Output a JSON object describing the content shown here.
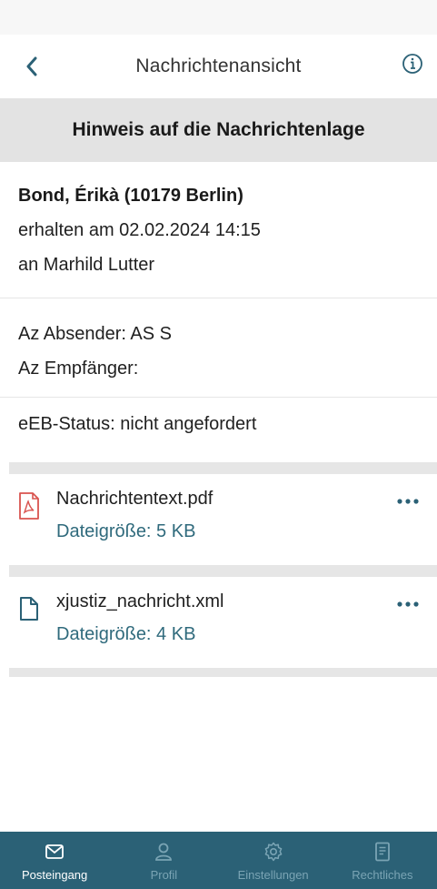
{
  "header": {
    "title": "Nachrichtenansicht",
    "back_icon": "chevron-left-icon",
    "info_icon": "info-circle-icon"
  },
  "subject": "Hinweis auf die Nachrichtenlage",
  "message": {
    "sender": "Bond, Érikà (10179 Berlin)",
    "received": "erhalten am 02.02.2024 14:15",
    "recipient": "an Marhild Lutter",
    "az_sender": "Az Absender: AS S",
    "az_recipient": "Az Empfänger:",
    "eeb_status": "eEB-Status: nicht angefordert"
  },
  "attachments": [
    {
      "name": "Nachrichtentext.pdf",
      "size": "Dateigröße: 5 KB",
      "icon": "pdf-file-icon"
    },
    {
      "name": "xjustiz_nachricht.xml",
      "size": "Dateigröße: 4 KB",
      "icon": "file-icon"
    }
  ],
  "tabs": [
    {
      "label": "Posteingang",
      "icon": "inbox-icon",
      "active": true
    },
    {
      "label": "Profil",
      "icon": "user-icon",
      "active": false
    },
    {
      "label": "Einstellungen",
      "icon": "gear-icon",
      "active": false
    },
    {
      "label": "Rechtliches",
      "icon": "document-icon",
      "active": false
    }
  ],
  "colors": {
    "tabbar": "#2b6176",
    "link": "#2f6a7c",
    "subject_bg": "#e3e3e3",
    "pdf_red": "#d9534f"
  }
}
